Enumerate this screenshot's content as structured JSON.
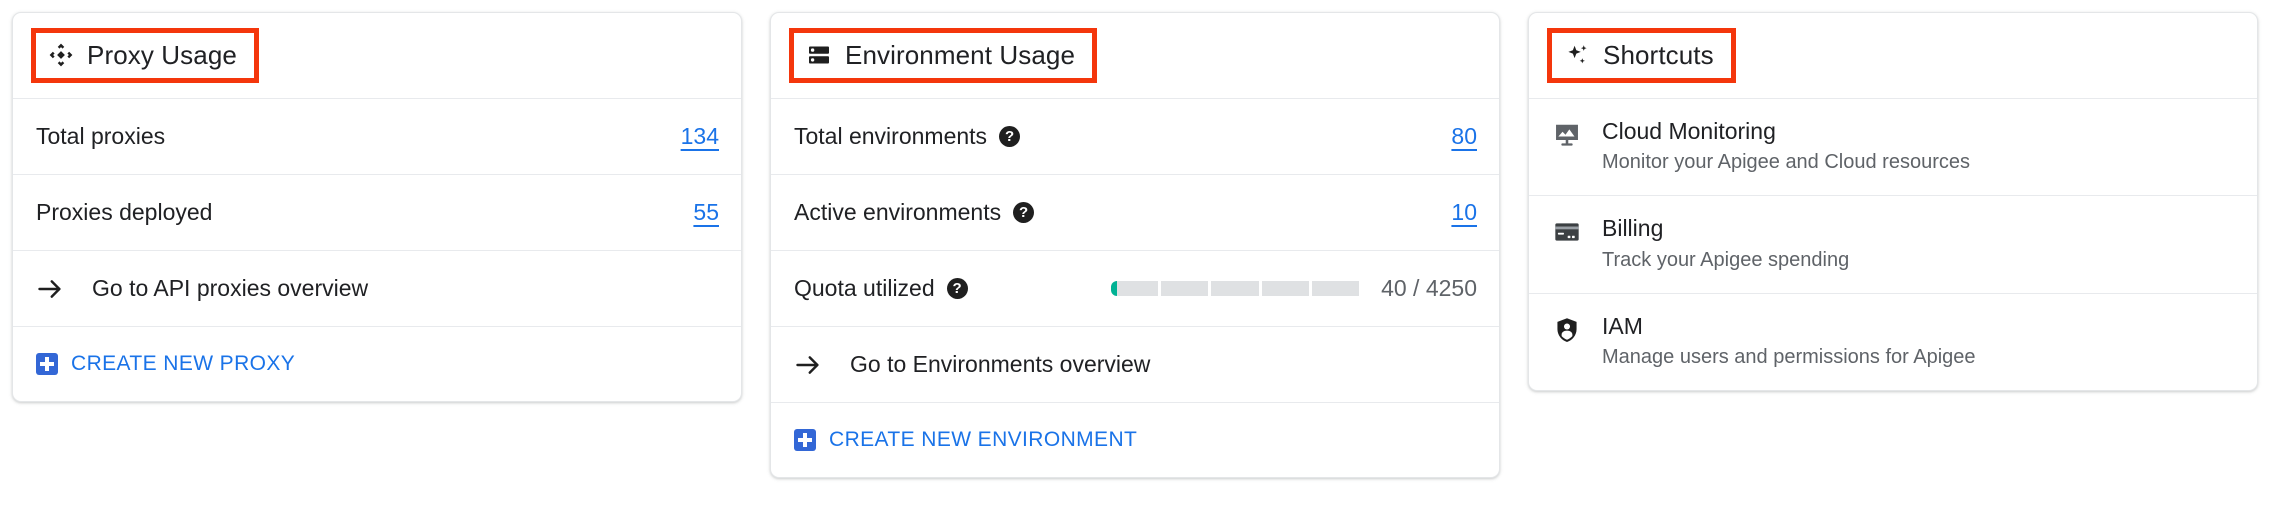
{
  "theme": {
    "accent_link": "#1a73e8",
    "highlight_box": "#f4360c",
    "quota_fill": "#00b294",
    "quota_track": "#dfe1e3",
    "text_primary": "#202124",
    "text_secondary": "#5f6368"
  },
  "proxy_card": {
    "icon": "proxy-diamond-icon",
    "title": "Proxy Usage",
    "rows": [
      {
        "label": "Total proxies",
        "value": "134"
      },
      {
        "label": "Proxies deployed",
        "value": "55"
      }
    ],
    "overview_link": {
      "icon": "arrow-right-icon",
      "label": "Go to API proxies overview"
    },
    "action": {
      "icon": "plus-square-icon",
      "label": "CREATE NEW PROXY"
    }
  },
  "environment_card": {
    "icon": "server-rack-icon",
    "title": "Environment Usage",
    "rows": [
      {
        "label": "Total environments",
        "help": "?",
        "value": "80"
      },
      {
        "label": "Active environments",
        "help": "?",
        "value": "10"
      }
    ],
    "quota": {
      "label": "Quota utilized",
      "help": "?",
      "text": "40 / 4250",
      "used": 40,
      "total": 4250,
      "segments": 5,
      "fill_percent": 0.94
    },
    "overview_link": {
      "icon": "arrow-right-icon",
      "label": "Go to Environments overview"
    },
    "action": {
      "icon": "plus-square-icon",
      "label": "CREATE NEW ENVIRONMENT"
    }
  },
  "shortcuts_card": {
    "icon": "sparkle-icon",
    "title": "Shortcuts",
    "items": [
      {
        "icon": "monitor-chart-icon",
        "title": "Cloud Monitoring",
        "subtitle": "Monitor your Apigee and Cloud resources"
      },
      {
        "icon": "credit-card-icon",
        "title": "Billing",
        "subtitle": "Track your Apigee spending"
      },
      {
        "icon": "shield-person-icon",
        "title": "IAM",
        "subtitle": "Manage users and permissions for Apigee"
      }
    ]
  }
}
